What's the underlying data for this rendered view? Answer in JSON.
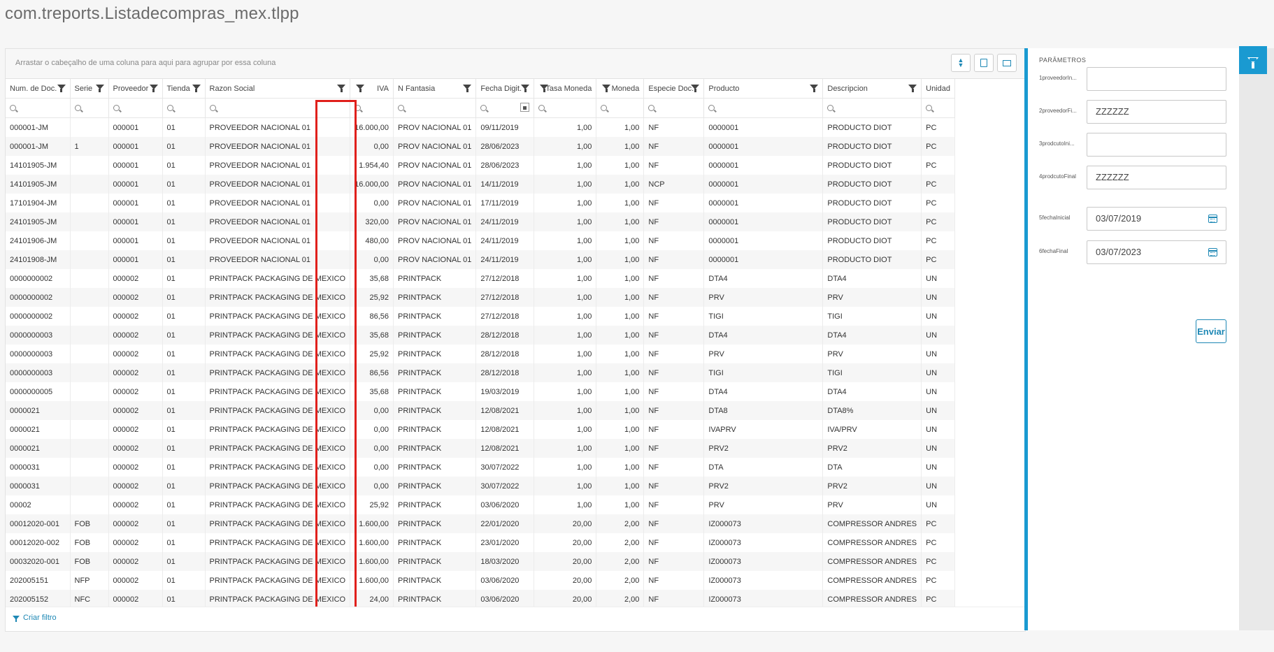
{
  "title": "com.treports.Listadecompras_mex.tlpp",
  "grid": {
    "group_hint": "Arrastar o cabeçalho de uma coluna para aqui para agrupar por essa coluna",
    "columns": [
      "Num. de Doc.",
      "Serie",
      "Proveedor",
      "Tienda",
      "Razon Social",
      "IVA",
      "N Fantasia",
      "Fecha Digit.",
      "Tasa Moneda",
      "Moneda",
      "Especie Doc.",
      "Producto",
      "Descripcion",
      "Unidad"
    ],
    "rows": [
      [
        "000001-JM",
        "",
        "000001",
        "01",
        "PROVEEDOR NACIONAL 01",
        "16.000,00",
        "PROV NACIONAL 01",
        "09/11/2019",
        "1,00",
        "1,00",
        "NF",
        "0000001",
        "PRODUCTO DIOT",
        "PC"
      ],
      [
        "000001-JM",
        "1",
        "000001",
        "01",
        "PROVEEDOR NACIONAL 01",
        "0,00",
        "PROV NACIONAL 01",
        "28/06/2023",
        "1,00",
        "1,00",
        "NF",
        "0000001",
        "PRODUCTO DIOT",
        "PC"
      ],
      [
        "14101905-JM",
        "",
        "000001",
        "01",
        "PROVEEDOR NACIONAL 01",
        "1.954,40",
        "PROV NACIONAL 01",
        "28/06/2023",
        "1,00",
        "1,00",
        "NF",
        "0000001",
        "PRODUCTO DIOT",
        "PC"
      ],
      [
        "14101905-JM",
        "",
        "000001",
        "01",
        "PROVEEDOR NACIONAL 01",
        "16.000,00",
        "PROV NACIONAL 01",
        "14/11/2019",
        "1,00",
        "1,00",
        "NCP",
        "0000001",
        "PRODUCTO DIOT",
        "PC"
      ],
      [
        "17101904-JM",
        "",
        "000001",
        "01",
        "PROVEEDOR NACIONAL 01",
        "0,00",
        "PROV NACIONAL 01",
        "17/11/2019",
        "1,00",
        "1,00",
        "NF",
        "0000001",
        "PRODUCTO DIOT",
        "PC"
      ],
      [
        "24101905-JM",
        "",
        "000001",
        "01",
        "PROVEEDOR NACIONAL 01",
        "320,00",
        "PROV NACIONAL 01",
        "24/11/2019",
        "1,00",
        "1,00",
        "NF",
        "0000001",
        "PRODUCTO DIOT",
        "PC"
      ],
      [
        "24101906-JM",
        "",
        "000001",
        "01",
        "PROVEEDOR NACIONAL 01",
        "480,00",
        "PROV NACIONAL 01",
        "24/11/2019",
        "1,00",
        "1,00",
        "NF",
        "0000001",
        "PRODUCTO DIOT",
        "PC"
      ],
      [
        "24101908-JM",
        "",
        "000001",
        "01",
        "PROVEEDOR NACIONAL 01",
        "0,00",
        "PROV NACIONAL 01",
        "24/11/2019",
        "1,00",
        "1,00",
        "NF",
        "0000001",
        "PRODUCTO DIOT",
        "PC"
      ],
      [
        "0000000002",
        "",
        "000002",
        "01",
        "PRINTPACK PACKAGING DE MEXICO",
        "35,68",
        "PRINTPACK",
        "27/12/2018",
        "1,00",
        "1,00",
        "NF",
        "DTA4",
        "DTA4",
        "UN"
      ],
      [
        "0000000002",
        "",
        "000002",
        "01",
        "PRINTPACK PACKAGING DE MEXICO",
        "25,92",
        "PRINTPACK",
        "27/12/2018",
        "1,00",
        "1,00",
        "NF",
        "PRV",
        "PRV",
        "UN"
      ],
      [
        "0000000002",
        "",
        "000002",
        "01",
        "PRINTPACK PACKAGING DE MEXICO",
        "86,56",
        "PRINTPACK",
        "27/12/2018",
        "1,00",
        "1,00",
        "NF",
        "TIGI",
        "TIGI",
        "UN"
      ],
      [
        "0000000003",
        "",
        "000002",
        "01",
        "PRINTPACK PACKAGING DE MEXICO",
        "35,68",
        "PRINTPACK",
        "28/12/2018",
        "1,00",
        "1,00",
        "NF",
        "DTA4",
        "DTA4",
        "UN"
      ],
      [
        "0000000003",
        "",
        "000002",
        "01",
        "PRINTPACK PACKAGING DE MEXICO",
        "25,92",
        "PRINTPACK",
        "28/12/2018",
        "1,00",
        "1,00",
        "NF",
        "PRV",
        "PRV",
        "UN"
      ],
      [
        "0000000003",
        "",
        "000002",
        "01",
        "PRINTPACK PACKAGING DE MEXICO",
        "86,56",
        "PRINTPACK",
        "28/12/2018",
        "1,00",
        "1,00",
        "NF",
        "TIGI",
        "TIGI",
        "UN"
      ],
      [
        "0000000005",
        "",
        "000002",
        "01",
        "PRINTPACK PACKAGING DE MEXICO",
        "35,68",
        "PRINTPACK",
        "19/03/2019",
        "1,00",
        "1,00",
        "NF",
        "DTA4",
        "DTA4",
        "UN"
      ],
      [
        "0000021",
        "",
        "000002",
        "01",
        "PRINTPACK PACKAGING DE MEXICO",
        "0,00",
        "PRINTPACK",
        "12/08/2021",
        "1,00",
        "1,00",
        "NF",
        "DTA8",
        "DTA8%",
        "UN"
      ],
      [
        "0000021",
        "",
        "000002",
        "01",
        "PRINTPACK PACKAGING DE MEXICO",
        "0,00",
        "PRINTPACK",
        "12/08/2021",
        "1,00",
        "1,00",
        "NF",
        "IVAPRV",
        "IVA/PRV",
        "UN"
      ],
      [
        "0000021",
        "",
        "000002",
        "01",
        "PRINTPACK PACKAGING DE MEXICO",
        "0,00",
        "PRINTPACK",
        "12/08/2021",
        "1,00",
        "1,00",
        "NF",
        "PRV2",
        "PRV2",
        "UN"
      ],
      [
        "0000031",
        "",
        "000002",
        "01",
        "PRINTPACK PACKAGING DE MEXICO",
        "0,00",
        "PRINTPACK",
        "30/07/2022",
        "1,00",
        "1,00",
        "NF",
        "DTA",
        "DTA",
        "UN"
      ],
      [
        "0000031",
        "",
        "000002",
        "01",
        "PRINTPACK PACKAGING DE MEXICO",
        "0,00",
        "PRINTPACK",
        "30/07/2022",
        "1,00",
        "1,00",
        "NF",
        "PRV2",
        "PRV2",
        "UN"
      ],
      [
        "00002",
        "",
        "000002",
        "01",
        "PRINTPACK PACKAGING DE MEXICO",
        "25,92",
        "PRINTPACK",
        "03/06/2020",
        "1,00",
        "1,00",
        "NF",
        "PRV",
        "PRV",
        "UN"
      ],
      [
        "00012020-001",
        "FOB",
        "000002",
        "01",
        "PRINTPACK PACKAGING DE MEXICO",
        "1.600,00",
        "PRINTPACK",
        "22/01/2020",
        "20,00",
        "2,00",
        "NF",
        "IZ000073",
        "COMPRESSOR ANDRES",
        "PC"
      ],
      [
        "00012020-002",
        "FOB",
        "000002",
        "01",
        "PRINTPACK PACKAGING DE MEXICO",
        "1.600,00",
        "PRINTPACK",
        "23/01/2020",
        "20,00",
        "2,00",
        "NF",
        "IZ000073",
        "COMPRESSOR ANDRES",
        "PC"
      ],
      [
        "00032020-001",
        "FOB",
        "000002",
        "01",
        "PRINTPACK PACKAGING DE MEXICO",
        "1.600,00",
        "PRINTPACK",
        "18/03/2020",
        "20,00",
        "2,00",
        "NF",
        "IZ000073",
        "COMPRESSOR ANDRES",
        "PC"
      ],
      [
        "202005151",
        "NFP",
        "000002",
        "01",
        "PRINTPACK PACKAGING DE MEXICO",
        "1.600,00",
        "PRINTPACK",
        "03/06/2020",
        "20,00",
        "2,00",
        "NF",
        "IZ000073",
        "COMPRESSOR ANDRES",
        "PC"
      ],
      [
        "202005152",
        "NFC",
        "000002",
        "01",
        "PRINTPACK PACKAGING DE MEXICO",
        "24,00",
        "PRINTPACK",
        "03/06/2020",
        "20,00",
        "2,00",
        "NF",
        "IZ000073",
        "COMPRESSOR ANDRES",
        "PC"
      ]
    ],
    "footer_link": "Criar filtro"
  },
  "params": {
    "title": "PARÂMETROS",
    "fields": [
      {
        "label": "1proveedorIn...",
        "value": ""
      },
      {
        "label": "2proveedorFi...",
        "value": "ZZZZZZ"
      },
      {
        "label": "3prodcutoIni...",
        "value": ""
      },
      {
        "label": "4prodcutoFinal",
        "value": "ZZZZZZ"
      },
      {
        "label": "5fechaInicial",
        "value": "03/07/2019"
      },
      {
        "label": "6fechaFinal",
        "value": "03/07/2023"
      }
    ],
    "submit_label": "Enviar"
  },
  "colors": {
    "accent": "#1a9ad1",
    "highlight": "#e0201c"
  }
}
